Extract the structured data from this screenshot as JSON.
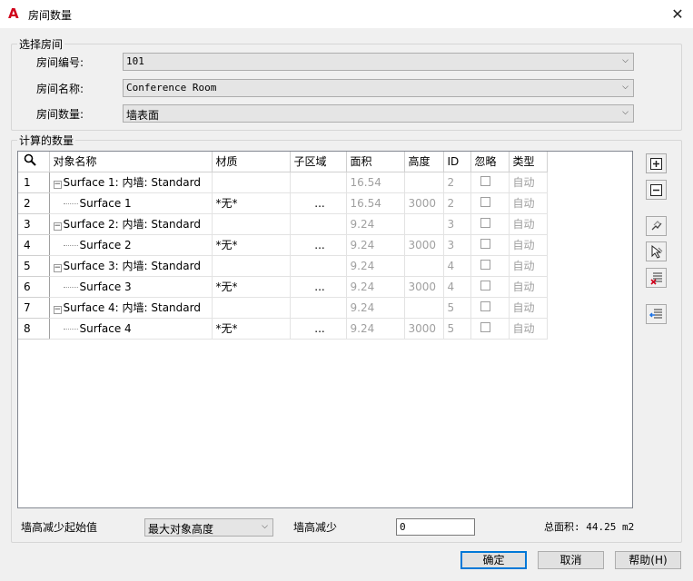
{
  "window": {
    "title": "房间数量",
    "app_icon": "autocad-a-icon",
    "close_glyph": "✕"
  },
  "select_room": {
    "legend": "选择房间",
    "room_number_label": "房间编号:",
    "room_number_value": "101",
    "room_name_label": "房间名称:",
    "room_name_value": "Conference Room",
    "room_quantity_label": "房间数量:",
    "room_quantity_value": "墙表面"
  },
  "calc": {
    "legend": "计算的数量",
    "columns": [
      "对象名称",
      "材质",
      "子区域",
      "面积",
      "高度",
      "ID",
      "忽略",
      "类型"
    ],
    "rows": [
      {
        "num": "1",
        "name": "Surface 1: 内墙: Standard",
        "level": 0,
        "material": "",
        "sub": "",
        "area": "16.54",
        "height": "",
        "id": "2",
        "type": "自动"
      },
      {
        "num": "2",
        "name": "Surface 1",
        "level": 1,
        "material": "*无*",
        "sub": "...",
        "area": "16.54",
        "height": "3000",
        "id": "2",
        "type": "自动"
      },
      {
        "num": "3",
        "name": "Surface 2: 内墙: Standard",
        "level": 0,
        "material": "",
        "sub": "",
        "area": "9.24",
        "height": "",
        "id": "3",
        "type": "自动"
      },
      {
        "num": "4",
        "name": "Surface 2",
        "level": 1,
        "material": "*无*",
        "sub": "...",
        "area": "9.24",
        "height": "3000",
        "id": "3",
        "type": "自动"
      },
      {
        "num": "5",
        "name": "Surface 3: 内墙: Standard",
        "level": 0,
        "material": "",
        "sub": "",
        "area": "9.24",
        "height": "",
        "id": "4",
        "type": "自动"
      },
      {
        "num": "6",
        "name": "Surface 3",
        "level": 1,
        "material": "*无*",
        "sub": "...",
        "area": "9.24",
        "height": "3000",
        "id": "4",
        "type": "自动"
      },
      {
        "num": "7",
        "name": "Surface 4: 内墙: Standard",
        "level": 0,
        "material": "",
        "sub": "",
        "area": "9.24",
        "height": "",
        "id": "5",
        "type": "自动"
      },
      {
        "num": "8",
        "name": "Surface 4",
        "level": 1,
        "material": "*无*",
        "sub": "...",
        "area": "9.24",
        "height": "3000",
        "id": "5",
        "type": "自动"
      }
    ]
  },
  "bottom": {
    "wall_height_start_label": "墙高减少起始值",
    "wall_height_start_value": "最大对象高度",
    "wall_height_reduce_label": "墙高减少",
    "wall_height_reduce_value": "0",
    "total_area": "总面积: 44.25 m2"
  },
  "buttons": {
    "ok": "确定",
    "cancel": "取消",
    "help": "帮助(H)"
  }
}
